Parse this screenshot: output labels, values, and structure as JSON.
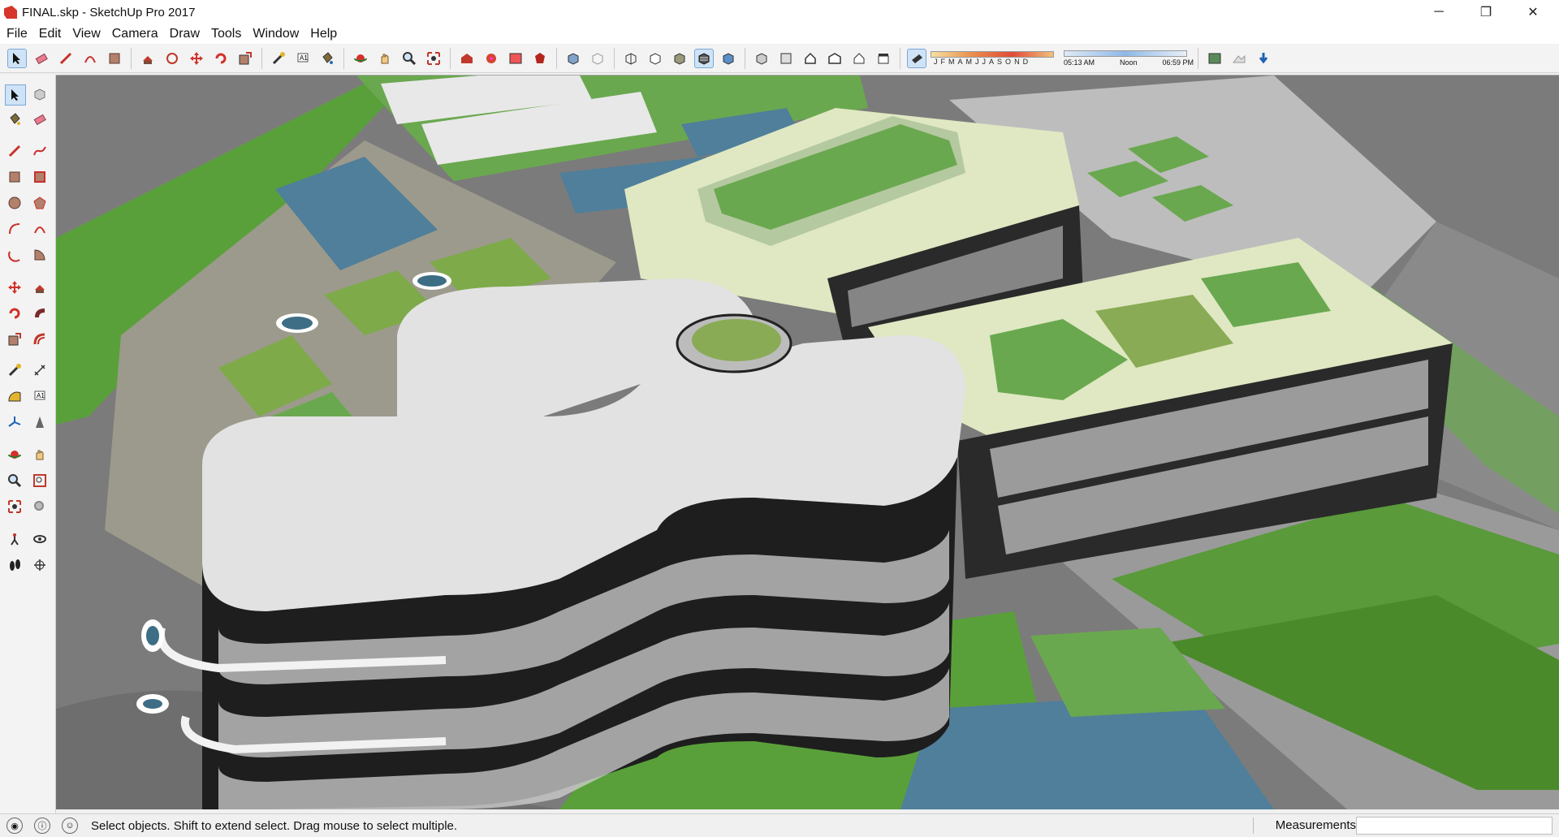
{
  "window": {
    "title": "FINAL.skp - SketchUp Pro 2017",
    "controls": {
      "minimize": "─",
      "restore": "❐",
      "close": "✕"
    }
  },
  "menu": [
    "File",
    "Edit",
    "View",
    "Camera",
    "Draw",
    "Tools",
    "Window",
    "Help"
  ],
  "toolbar": {
    "months": [
      "J",
      "F",
      "M",
      "A",
      "M",
      "J",
      "J",
      "A",
      "S",
      "O",
      "N",
      "D"
    ],
    "time_start": "05:13 AM",
    "time_mid": "Noon",
    "time_end": "06:59 PM"
  },
  "status": {
    "hint": "Select objects. Shift to extend select. Drag mouse to select multiple.",
    "measurements_label": "Measurements",
    "measurements_value": ""
  },
  "colors": {
    "accent": "#0078d7",
    "lawn": "#6aa84f",
    "roof_light": "#dfe8c2",
    "road": "#6e6e6e",
    "water": "#4f7f9a"
  }
}
